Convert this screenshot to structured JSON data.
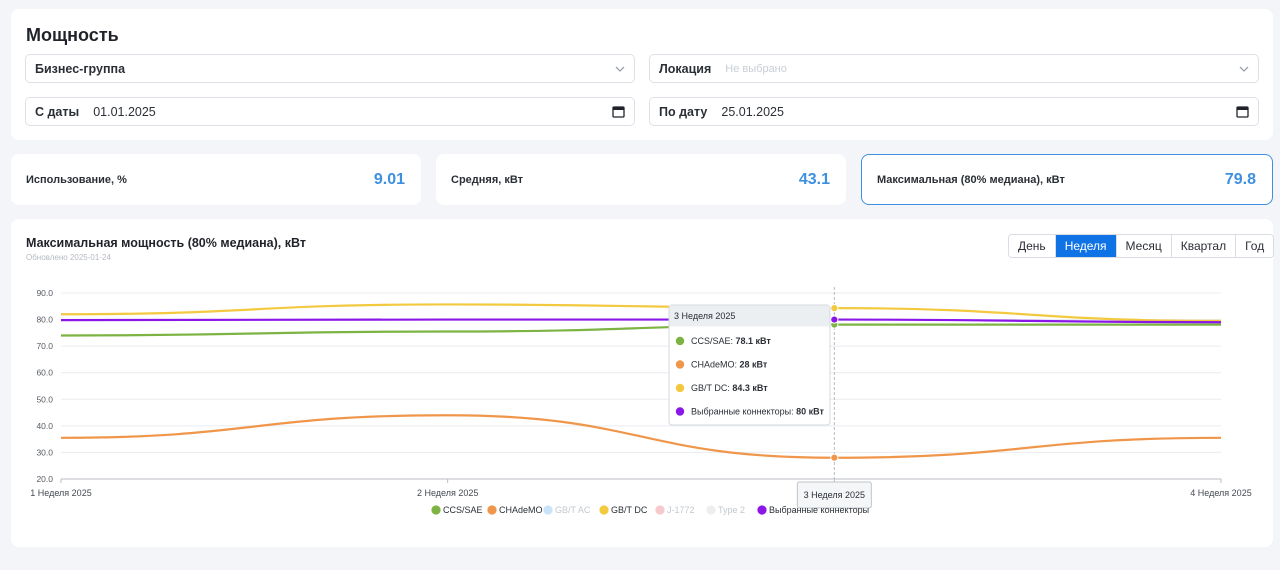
{
  "filters": {
    "title": "Мощность",
    "business_group": {
      "label": "Бизнес-группа"
    },
    "location": {
      "label": "Локация",
      "placeholder": "Не выбрано"
    },
    "date_from": {
      "label": "С даты",
      "value": "01.01.2025"
    },
    "date_to": {
      "label": "По дату",
      "value": "25.01.2025"
    }
  },
  "kpis": [
    {
      "label": "Использование, %",
      "value": "9.01"
    },
    {
      "label": "Средняя, кВт",
      "value": "43.1"
    },
    {
      "label": "Максимальная (80% медиана), кВт",
      "value": "79.8"
    }
  ],
  "chart": {
    "title": "Максимальная мощность (80% медиана), кВт",
    "updated": "Обновлено 2025-01-24",
    "periods": [
      "День",
      "Неделя",
      "Месяц",
      "Квартал",
      "Год"
    ],
    "active_period": "Неделя"
  },
  "chart_data": {
    "type": "line",
    "x": [
      "1 Неделя 2025",
      "2 Неделя 2025",
      "3 Неделя 2025",
      "4 Неделя 2025"
    ],
    "ylim": [
      20,
      90
    ],
    "yticks": [
      20,
      30,
      40,
      50,
      60,
      70,
      80,
      90
    ],
    "series": [
      {
        "name": "CCS/SAE",
        "color": "#7cb342",
        "values": [
          74.0,
          75.5,
          78.1,
          78.1
        ],
        "visible": true
      },
      {
        "name": "CHAdeMO",
        "color": "#f0964a",
        "values": [
          35.5,
          44.0,
          28.0,
          35.5
        ],
        "visible": true
      },
      {
        "name": "GB/T AC",
        "color": "#c9e3f8",
        "values": [],
        "visible": false
      },
      {
        "name": "GB/T DC",
        "color": "#f3c940",
        "values": [
          82.0,
          85.7,
          84.3,
          79.5
        ],
        "visible": true
      },
      {
        "name": "J-1772",
        "color": "#f6c9cc",
        "values": [],
        "visible": false
      },
      {
        "name": "Type 2",
        "color": "#eeeeee",
        "values": [],
        "visible": false
      },
      {
        "name": "Выбранные коннекторы",
        "color": "#8b16e8",
        "values": [
          79.8,
          80.0,
          80.0,
          79.0
        ],
        "visible": true
      }
    ],
    "tooltip": {
      "index": 2,
      "title": "3 Неделя 2025",
      "rows": [
        {
          "name": "CCS/SAE",
          "value": "78.1 кВт"
        },
        {
          "name": "CHAdeMO",
          "value": "28 кВт"
        },
        {
          "name": "GB/T DC",
          "value": "84.3 кВт"
        },
        {
          "name": "Выбранные коннекторы",
          "value": "80 кВт"
        }
      ]
    }
  }
}
